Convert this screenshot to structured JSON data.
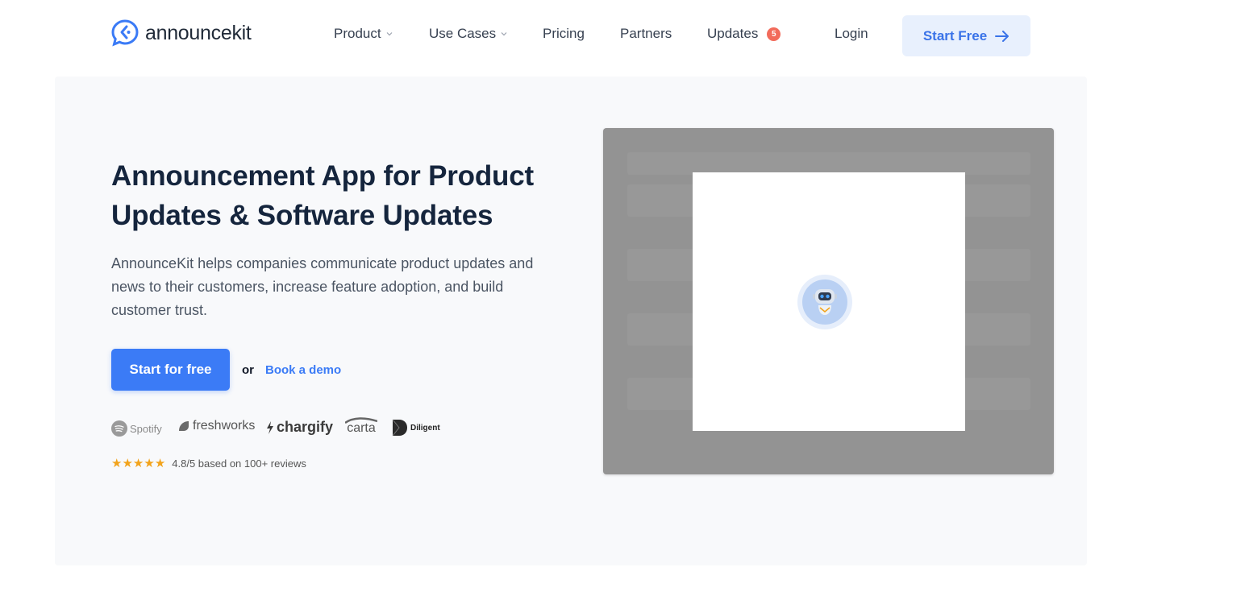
{
  "brand": {
    "logo_text_announce": "announce",
    "logo_text_kit": "kit"
  },
  "nav": {
    "items": [
      {
        "label": "Product",
        "has_dropdown": true
      },
      {
        "label": "Use Cases",
        "has_dropdown": true
      },
      {
        "label": "Pricing",
        "has_dropdown": false
      },
      {
        "label": "Partners",
        "has_dropdown": false
      },
      {
        "label": "Updates",
        "has_dropdown": false,
        "badge": "5"
      }
    ],
    "login_label": "Login",
    "start_free_label": "Start Free"
  },
  "hero": {
    "title": "Announcement App for Product Updates & Software Updates",
    "description": "AnnounceKit helps companies communicate product updates and news to their customers, increase feature adoption, and build customer trust.",
    "cta_primary": "Start for free",
    "cta_or": "or",
    "cta_secondary": "Book a demo",
    "customer_logos": [
      "Spotify",
      "freshworks",
      "chargify",
      "carta",
      "Diligent"
    ],
    "rating_stars": 5,
    "rating_text": "4.8/5 based on 100+ reviews"
  },
  "colors": {
    "accent": "#3b7bf6",
    "title": "#15253d",
    "hero_bg": "#f8f9fb",
    "badge": "#f26b5b",
    "star": "#f2a31b",
    "overlay": "#939393"
  }
}
